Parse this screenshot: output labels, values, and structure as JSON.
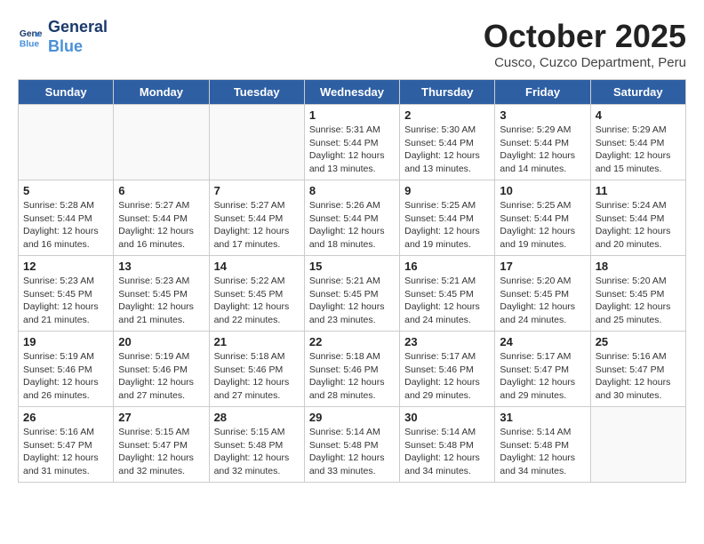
{
  "header": {
    "logo_line1": "General",
    "logo_line2": "Blue",
    "month_title": "October 2025",
    "location": "Cusco, Cuzco Department, Peru"
  },
  "days_of_week": [
    "Sunday",
    "Monday",
    "Tuesday",
    "Wednesday",
    "Thursday",
    "Friday",
    "Saturday"
  ],
  "weeks": [
    [
      {
        "day": "",
        "info": ""
      },
      {
        "day": "",
        "info": ""
      },
      {
        "day": "",
        "info": ""
      },
      {
        "day": "1",
        "info": "Sunrise: 5:31 AM\nSunset: 5:44 PM\nDaylight: 12 hours and 13 minutes."
      },
      {
        "day": "2",
        "info": "Sunrise: 5:30 AM\nSunset: 5:44 PM\nDaylight: 12 hours and 13 minutes."
      },
      {
        "day": "3",
        "info": "Sunrise: 5:29 AM\nSunset: 5:44 PM\nDaylight: 12 hours and 14 minutes."
      },
      {
        "day": "4",
        "info": "Sunrise: 5:29 AM\nSunset: 5:44 PM\nDaylight: 12 hours and 15 minutes."
      }
    ],
    [
      {
        "day": "5",
        "info": "Sunrise: 5:28 AM\nSunset: 5:44 PM\nDaylight: 12 hours and 16 minutes."
      },
      {
        "day": "6",
        "info": "Sunrise: 5:27 AM\nSunset: 5:44 PM\nDaylight: 12 hours and 16 minutes."
      },
      {
        "day": "7",
        "info": "Sunrise: 5:27 AM\nSunset: 5:44 PM\nDaylight: 12 hours and 17 minutes."
      },
      {
        "day": "8",
        "info": "Sunrise: 5:26 AM\nSunset: 5:44 PM\nDaylight: 12 hours and 18 minutes."
      },
      {
        "day": "9",
        "info": "Sunrise: 5:25 AM\nSunset: 5:44 PM\nDaylight: 12 hours and 19 minutes."
      },
      {
        "day": "10",
        "info": "Sunrise: 5:25 AM\nSunset: 5:44 PM\nDaylight: 12 hours and 19 minutes."
      },
      {
        "day": "11",
        "info": "Sunrise: 5:24 AM\nSunset: 5:44 PM\nDaylight: 12 hours and 20 minutes."
      }
    ],
    [
      {
        "day": "12",
        "info": "Sunrise: 5:23 AM\nSunset: 5:45 PM\nDaylight: 12 hours and 21 minutes."
      },
      {
        "day": "13",
        "info": "Sunrise: 5:23 AM\nSunset: 5:45 PM\nDaylight: 12 hours and 21 minutes."
      },
      {
        "day": "14",
        "info": "Sunrise: 5:22 AM\nSunset: 5:45 PM\nDaylight: 12 hours and 22 minutes."
      },
      {
        "day": "15",
        "info": "Sunrise: 5:21 AM\nSunset: 5:45 PM\nDaylight: 12 hours and 23 minutes."
      },
      {
        "day": "16",
        "info": "Sunrise: 5:21 AM\nSunset: 5:45 PM\nDaylight: 12 hours and 24 minutes."
      },
      {
        "day": "17",
        "info": "Sunrise: 5:20 AM\nSunset: 5:45 PM\nDaylight: 12 hours and 24 minutes."
      },
      {
        "day": "18",
        "info": "Sunrise: 5:20 AM\nSunset: 5:45 PM\nDaylight: 12 hours and 25 minutes."
      }
    ],
    [
      {
        "day": "19",
        "info": "Sunrise: 5:19 AM\nSunset: 5:46 PM\nDaylight: 12 hours and 26 minutes."
      },
      {
        "day": "20",
        "info": "Sunrise: 5:19 AM\nSunset: 5:46 PM\nDaylight: 12 hours and 27 minutes."
      },
      {
        "day": "21",
        "info": "Sunrise: 5:18 AM\nSunset: 5:46 PM\nDaylight: 12 hours and 27 minutes."
      },
      {
        "day": "22",
        "info": "Sunrise: 5:18 AM\nSunset: 5:46 PM\nDaylight: 12 hours and 28 minutes."
      },
      {
        "day": "23",
        "info": "Sunrise: 5:17 AM\nSunset: 5:46 PM\nDaylight: 12 hours and 29 minutes."
      },
      {
        "day": "24",
        "info": "Sunrise: 5:17 AM\nSunset: 5:47 PM\nDaylight: 12 hours and 29 minutes."
      },
      {
        "day": "25",
        "info": "Sunrise: 5:16 AM\nSunset: 5:47 PM\nDaylight: 12 hours and 30 minutes."
      }
    ],
    [
      {
        "day": "26",
        "info": "Sunrise: 5:16 AM\nSunset: 5:47 PM\nDaylight: 12 hours and 31 minutes."
      },
      {
        "day": "27",
        "info": "Sunrise: 5:15 AM\nSunset: 5:47 PM\nDaylight: 12 hours and 32 minutes."
      },
      {
        "day": "28",
        "info": "Sunrise: 5:15 AM\nSunset: 5:48 PM\nDaylight: 12 hours and 32 minutes."
      },
      {
        "day": "29",
        "info": "Sunrise: 5:14 AM\nSunset: 5:48 PM\nDaylight: 12 hours and 33 minutes."
      },
      {
        "day": "30",
        "info": "Sunrise: 5:14 AM\nSunset: 5:48 PM\nDaylight: 12 hours and 34 minutes."
      },
      {
        "day": "31",
        "info": "Sunrise: 5:14 AM\nSunset: 5:48 PM\nDaylight: 12 hours and 34 minutes."
      },
      {
        "day": "",
        "info": ""
      }
    ]
  ]
}
